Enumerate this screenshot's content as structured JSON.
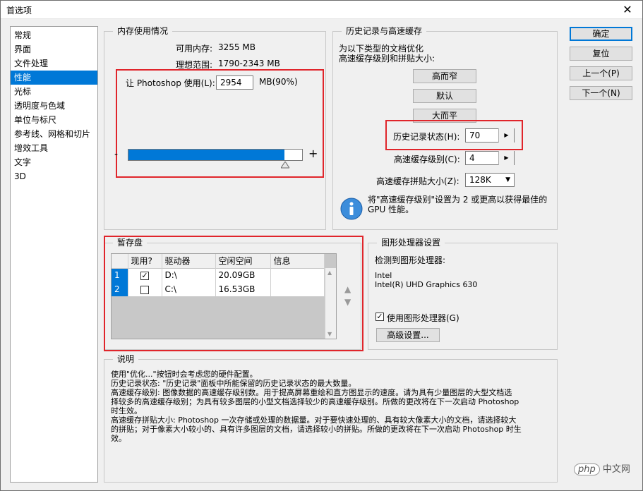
{
  "window": {
    "title": "首选项"
  },
  "sidebar": {
    "items": [
      {
        "label": "常规"
      },
      {
        "label": "界面"
      },
      {
        "label": "文件处理"
      },
      {
        "label": "性能"
      },
      {
        "label": "光标"
      },
      {
        "label": "透明度与色域"
      },
      {
        "label": "单位与标尺"
      },
      {
        "label": "参考线、网格和切片"
      },
      {
        "label": "增效工具"
      },
      {
        "label": "文字"
      },
      {
        "label": "3D"
      }
    ],
    "active_index": 3
  },
  "memory": {
    "title": "内存使用情况",
    "available_label": "可用内存:",
    "available_value": "3255 MB",
    "ideal_label": "理想范围:",
    "ideal_value": "1790-2343 MB",
    "let_label": "让 Photoshop 使用(L):",
    "value": "2954",
    "unit": "MB(90%)",
    "slider_percent": 90,
    "minus": "-",
    "plus": "+"
  },
  "history": {
    "title": "历史记录与高速缓存",
    "desc_line1": "为以下类型的文档优化",
    "desc_line2": "高速缓存级别和拼贴大小:",
    "btn_tall": "高而窄",
    "btn_default": "默认",
    "btn_flat": "大而平",
    "states_label": "历史记录状态(H):",
    "states_value": "70",
    "cache_levels_label": "高速缓存级别(C):",
    "cache_levels_value": "4",
    "tile_label": "高速缓存拼贴大小(Z):",
    "tile_value": "128K",
    "info_line1": "将\"高速缓存级别\"设置为 2 或更高以获得最佳的",
    "info_line2": "GPU 性能。"
  },
  "scratch": {
    "title": "暂存盘",
    "columns": [
      "现用?",
      "驱动器",
      "空闲空间",
      "信息"
    ],
    "rows": [
      {
        "num": "1",
        "checked": "✓",
        "drive": "D:\\",
        "free": "20.09GB",
        "info": ""
      },
      {
        "num": "2",
        "checked": "",
        "drive": "C:\\",
        "free": "16.53GB",
        "info": ""
      }
    ]
  },
  "gpu": {
    "title": "图形处理器设置",
    "detected_label": "检测到图形处理器:",
    "vendor": "Intel",
    "model": "Intel(R) UHD Graphics 630",
    "use_gpu_label": "使用图形处理器(G)",
    "use_gpu_checked": "✓",
    "advanced_button": "高级设置..."
  },
  "description": {
    "title": "说明",
    "lines": [
      "使用\"优化...\"按钮时会考虑您的硬件配置。",
      "历史记录状态: \"历史记录\"面板中所能保留的历史记录状态的最大数量。",
      "高速缓存级别: 图像数据的高速缓存级别数。用于提高屏幕重绘和直方图显示的速度。请为具有少量图层的大型文档选",
      "择较多的高速缓存级别；为具有较多图层的小型文档选择较少的高速缓存级别。所做的更改将在下一次启动 Photoshop",
      "时生效。",
      "高速缓存拼贴大小: Photoshop 一次存储或处理的数据量。对于要快速处理的、具有较大像素大小的文档，请选择较大",
      "的拼贴；对于像素大小较小的、具有许多图层的文档，请选择较小的拼贴。所做的更改将在下一次启动 Photoshop 时生",
      "效。"
    ]
  },
  "buttons": {
    "ok": "确定",
    "reset": "复位",
    "prev": "上一个(P)",
    "next": "下一个(N)"
  },
  "watermark": "php 中文网",
  "colors": {
    "accent": "#0078d7",
    "highlight": "#e0252b"
  }
}
